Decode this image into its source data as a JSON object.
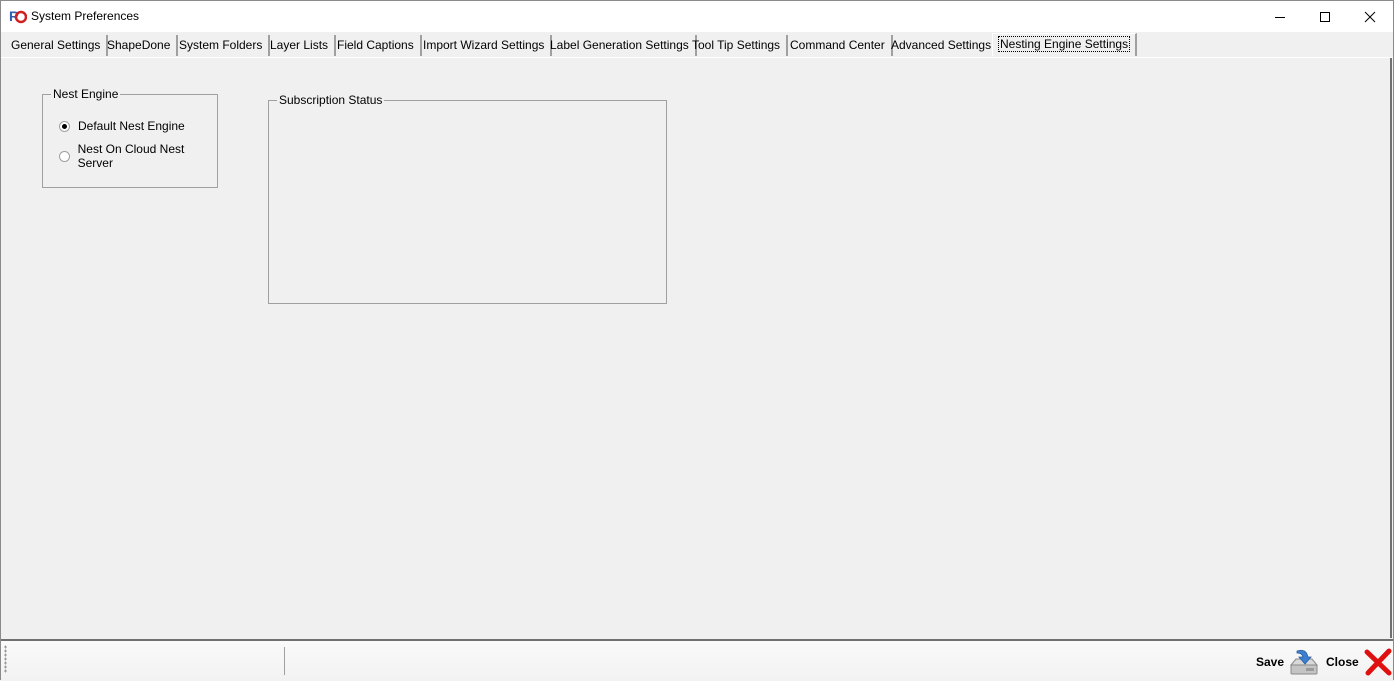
{
  "window": {
    "title": "System Preferences",
    "app_icon": "rs-logo-icon",
    "controls": [
      "minimize",
      "maximize",
      "close"
    ]
  },
  "tabs": [
    {
      "label": "General Settings",
      "active": false
    },
    {
      "label": "ShapeDone",
      "active": false
    },
    {
      "label": "System Folders",
      "active": false
    },
    {
      "label": "Layer Lists",
      "active": false
    },
    {
      "label": "Field Captions",
      "active": false
    },
    {
      "label": "Import Wizard Settings",
      "active": false
    },
    {
      "label": "Label Generation Settings",
      "active": false
    },
    {
      "label": "Tool Tip Settings",
      "active": false
    },
    {
      "label": "Command Center",
      "active": false
    },
    {
      "label": "Advanced Settings",
      "active": false
    },
    {
      "label": "Nesting Engine Settings",
      "active": true
    }
  ],
  "nest_engine": {
    "legend": "Nest Engine",
    "options": [
      {
        "label": "Default Nest Engine",
        "checked": true
      },
      {
        "label": "Nest On Cloud Nest Server",
        "checked": false
      }
    ]
  },
  "subscription_status": {
    "legend": "Subscription Status"
  },
  "statusbar": {
    "save_label": "Save",
    "save_icon": "save-drive-icon",
    "close_label": "Close",
    "close_icon": "red-x-icon",
    "colors": {
      "close_x": "#e01010",
      "save_arrow": "#3a7fd0"
    }
  }
}
